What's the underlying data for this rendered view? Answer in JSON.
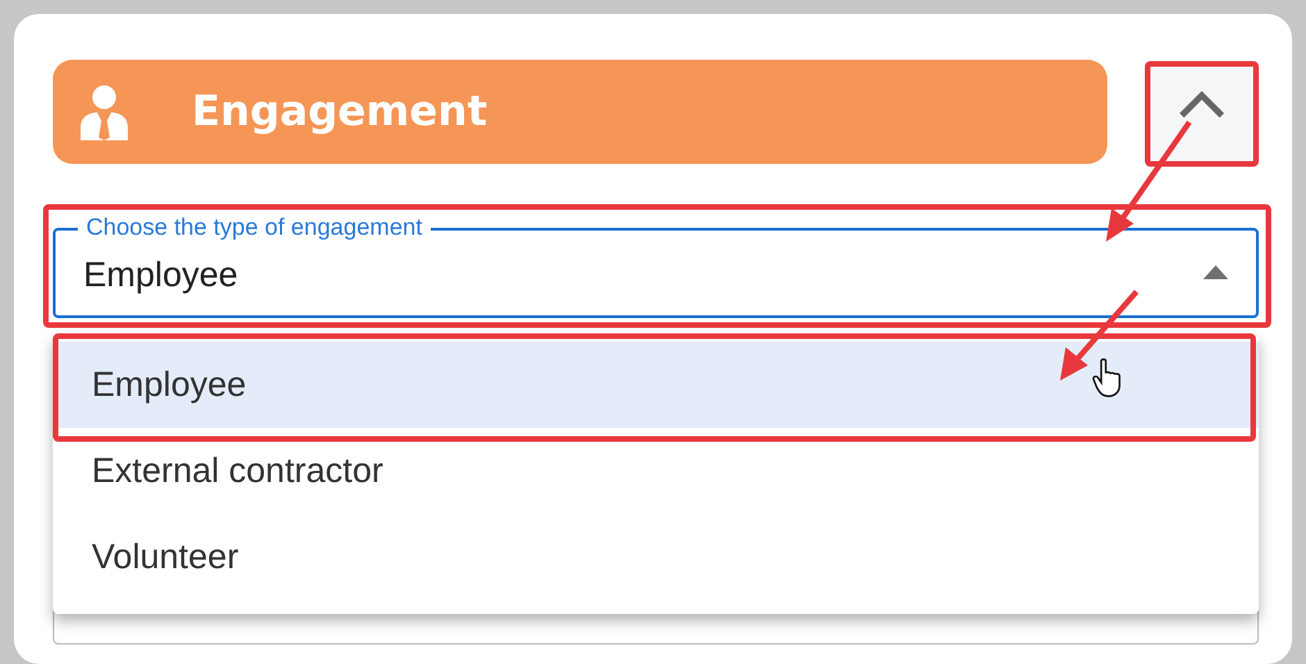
{
  "section": {
    "title": "Engagement",
    "expanded": true
  },
  "field": {
    "label": "Choose the type of engagement",
    "value": "Employee",
    "open": true
  },
  "options": [
    {
      "label": "Employee",
      "selected": true
    },
    {
      "label": "External contractor",
      "selected": false
    },
    {
      "label": "Volunteer",
      "selected": false
    }
  ]
}
